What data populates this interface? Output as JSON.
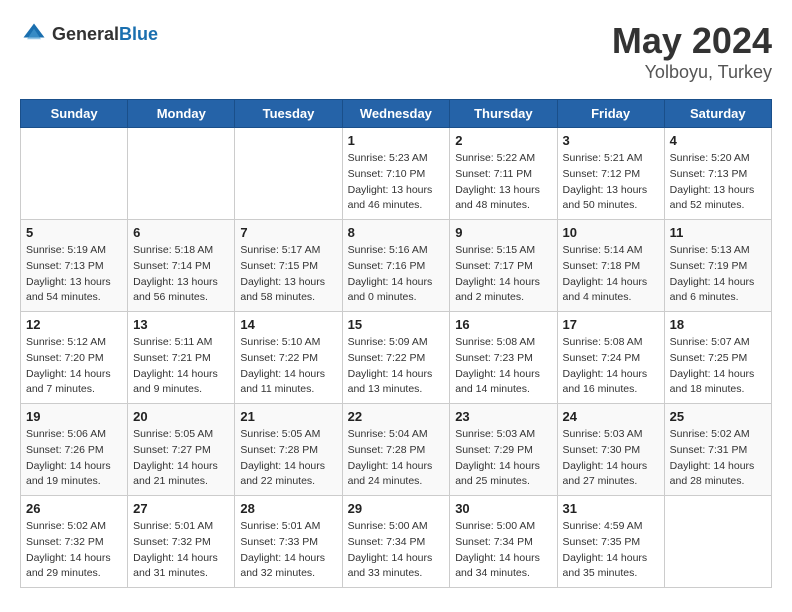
{
  "header": {
    "logo_general": "General",
    "logo_blue": "Blue",
    "month": "May 2024",
    "location": "Yolboyu, Turkey"
  },
  "days_of_week": [
    "Sunday",
    "Monday",
    "Tuesday",
    "Wednesday",
    "Thursday",
    "Friday",
    "Saturday"
  ],
  "weeks": [
    [
      {
        "day": "",
        "sunrise": "",
        "sunset": "",
        "daylight": ""
      },
      {
        "day": "",
        "sunrise": "",
        "sunset": "",
        "daylight": ""
      },
      {
        "day": "",
        "sunrise": "",
        "sunset": "",
        "daylight": ""
      },
      {
        "day": "1",
        "sunrise": "Sunrise: 5:23 AM",
        "sunset": "Sunset: 7:10 PM",
        "daylight": "Daylight: 13 hours and 46 minutes."
      },
      {
        "day": "2",
        "sunrise": "Sunrise: 5:22 AM",
        "sunset": "Sunset: 7:11 PM",
        "daylight": "Daylight: 13 hours and 48 minutes."
      },
      {
        "day": "3",
        "sunrise": "Sunrise: 5:21 AM",
        "sunset": "Sunset: 7:12 PM",
        "daylight": "Daylight: 13 hours and 50 minutes."
      },
      {
        "day": "4",
        "sunrise": "Sunrise: 5:20 AM",
        "sunset": "Sunset: 7:13 PM",
        "daylight": "Daylight: 13 hours and 52 minutes."
      }
    ],
    [
      {
        "day": "5",
        "sunrise": "Sunrise: 5:19 AM",
        "sunset": "Sunset: 7:13 PM",
        "daylight": "Daylight: 13 hours and 54 minutes."
      },
      {
        "day": "6",
        "sunrise": "Sunrise: 5:18 AM",
        "sunset": "Sunset: 7:14 PM",
        "daylight": "Daylight: 13 hours and 56 minutes."
      },
      {
        "day": "7",
        "sunrise": "Sunrise: 5:17 AM",
        "sunset": "Sunset: 7:15 PM",
        "daylight": "Daylight: 13 hours and 58 minutes."
      },
      {
        "day": "8",
        "sunrise": "Sunrise: 5:16 AM",
        "sunset": "Sunset: 7:16 PM",
        "daylight": "Daylight: 14 hours and 0 minutes."
      },
      {
        "day": "9",
        "sunrise": "Sunrise: 5:15 AM",
        "sunset": "Sunset: 7:17 PM",
        "daylight": "Daylight: 14 hours and 2 minutes."
      },
      {
        "day": "10",
        "sunrise": "Sunrise: 5:14 AM",
        "sunset": "Sunset: 7:18 PM",
        "daylight": "Daylight: 14 hours and 4 minutes."
      },
      {
        "day": "11",
        "sunrise": "Sunrise: 5:13 AM",
        "sunset": "Sunset: 7:19 PM",
        "daylight": "Daylight: 14 hours and 6 minutes."
      }
    ],
    [
      {
        "day": "12",
        "sunrise": "Sunrise: 5:12 AM",
        "sunset": "Sunset: 7:20 PM",
        "daylight": "Daylight: 14 hours and 7 minutes."
      },
      {
        "day": "13",
        "sunrise": "Sunrise: 5:11 AM",
        "sunset": "Sunset: 7:21 PM",
        "daylight": "Daylight: 14 hours and 9 minutes."
      },
      {
        "day": "14",
        "sunrise": "Sunrise: 5:10 AM",
        "sunset": "Sunset: 7:22 PM",
        "daylight": "Daylight: 14 hours and 11 minutes."
      },
      {
        "day": "15",
        "sunrise": "Sunrise: 5:09 AM",
        "sunset": "Sunset: 7:22 PM",
        "daylight": "Daylight: 14 hours and 13 minutes."
      },
      {
        "day": "16",
        "sunrise": "Sunrise: 5:08 AM",
        "sunset": "Sunset: 7:23 PM",
        "daylight": "Daylight: 14 hours and 14 minutes."
      },
      {
        "day": "17",
        "sunrise": "Sunrise: 5:08 AM",
        "sunset": "Sunset: 7:24 PM",
        "daylight": "Daylight: 14 hours and 16 minutes."
      },
      {
        "day": "18",
        "sunrise": "Sunrise: 5:07 AM",
        "sunset": "Sunset: 7:25 PM",
        "daylight": "Daylight: 14 hours and 18 minutes."
      }
    ],
    [
      {
        "day": "19",
        "sunrise": "Sunrise: 5:06 AM",
        "sunset": "Sunset: 7:26 PM",
        "daylight": "Daylight: 14 hours and 19 minutes."
      },
      {
        "day": "20",
        "sunrise": "Sunrise: 5:05 AM",
        "sunset": "Sunset: 7:27 PM",
        "daylight": "Daylight: 14 hours and 21 minutes."
      },
      {
        "day": "21",
        "sunrise": "Sunrise: 5:05 AM",
        "sunset": "Sunset: 7:28 PM",
        "daylight": "Daylight: 14 hours and 22 minutes."
      },
      {
        "day": "22",
        "sunrise": "Sunrise: 5:04 AM",
        "sunset": "Sunset: 7:28 PM",
        "daylight": "Daylight: 14 hours and 24 minutes."
      },
      {
        "day": "23",
        "sunrise": "Sunrise: 5:03 AM",
        "sunset": "Sunset: 7:29 PM",
        "daylight": "Daylight: 14 hours and 25 minutes."
      },
      {
        "day": "24",
        "sunrise": "Sunrise: 5:03 AM",
        "sunset": "Sunset: 7:30 PM",
        "daylight": "Daylight: 14 hours and 27 minutes."
      },
      {
        "day": "25",
        "sunrise": "Sunrise: 5:02 AM",
        "sunset": "Sunset: 7:31 PM",
        "daylight": "Daylight: 14 hours and 28 minutes."
      }
    ],
    [
      {
        "day": "26",
        "sunrise": "Sunrise: 5:02 AM",
        "sunset": "Sunset: 7:32 PM",
        "daylight": "Daylight: 14 hours and 29 minutes."
      },
      {
        "day": "27",
        "sunrise": "Sunrise: 5:01 AM",
        "sunset": "Sunset: 7:32 PM",
        "daylight": "Daylight: 14 hours and 31 minutes."
      },
      {
        "day": "28",
        "sunrise": "Sunrise: 5:01 AM",
        "sunset": "Sunset: 7:33 PM",
        "daylight": "Daylight: 14 hours and 32 minutes."
      },
      {
        "day": "29",
        "sunrise": "Sunrise: 5:00 AM",
        "sunset": "Sunset: 7:34 PM",
        "daylight": "Daylight: 14 hours and 33 minutes."
      },
      {
        "day": "30",
        "sunrise": "Sunrise: 5:00 AM",
        "sunset": "Sunset: 7:34 PM",
        "daylight": "Daylight: 14 hours and 34 minutes."
      },
      {
        "day": "31",
        "sunrise": "Sunrise: 4:59 AM",
        "sunset": "Sunset: 7:35 PM",
        "daylight": "Daylight: 14 hours and 35 minutes."
      },
      {
        "day": "",
        "sunrise": "",
        "sunset": "",
        "daylight": ""
      }
    ]
  ]
}
